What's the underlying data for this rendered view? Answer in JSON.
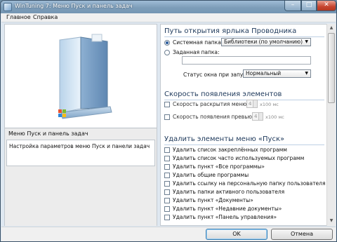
{
  "window": {
    "title": "WinTuning 7: Меню Пуск и панель задач"
  },
  "menu": {
    "items": [
      "Главное",
      "Справка"
    ]
  },
  "left": {
    "info_title": "Меню Пуск и панель задач",
    "info_desc": "Настройка параметров меню Пуск и панели задач"
  },
  "explorer_path": {
    "title": "Путь открытия ярлыка Проводника",
    "system_folder_label": "Системная папка:",
    "system_folder_value": "Библиотеки (по умолчанию)",
    "custom_folder_label": "Заданная папка:",
    "custom_folder_value": "",
    "window_state_label": "Статус окна при запуске:",
    "window_state_value": "Нормальный"
  },
  "speed": {
    "title": "Скорость появления элементов",
    "menu_label": "Скорость раскрытия меню:",
    "menu_value": "4",
    "menu_unit": "x100 мс",
    "preview_label": "Скорость появления превью:",
    "preview_value": "4",
    "preview_unit": "x100 мс"
  },
  "remove": {
    "title": "Удалить элементы меню «Пуск»",
    "items": [
      "Удалить список закреплённых программ",
      "Удалить список часто используемых программ",
      "Удалить пункт «Все программы»",
      "Удалить общие программы",
      "Удалить ссылку на персональную папку пользователя",
      "Удалить папки активного пользователя",
      "Удалить пункт «Документы»",
      "Удалить пункт «Недавние документы»",
      "Удалить пункт «Панель управления»"
    ]
  },
  "buttons": {
    "ok": "OK",
    "cancel": "Отмена"
  },
  "icons": {
    "app": "app-icon",
    "minimize": "minimize-icon",
    "maximize": "maximize-icon",
    "close": "close-icon",
    "dropdown": "chevron-down-icon",
    "preview": "start-menu-preview-icon",
    "windows_logo": "windows-logo-icon"
  },
  "colors": {
    "accent": "#1e395b",
    "titlebar": "#7d9db9",
    "close": "#c7452f"
  }
}
